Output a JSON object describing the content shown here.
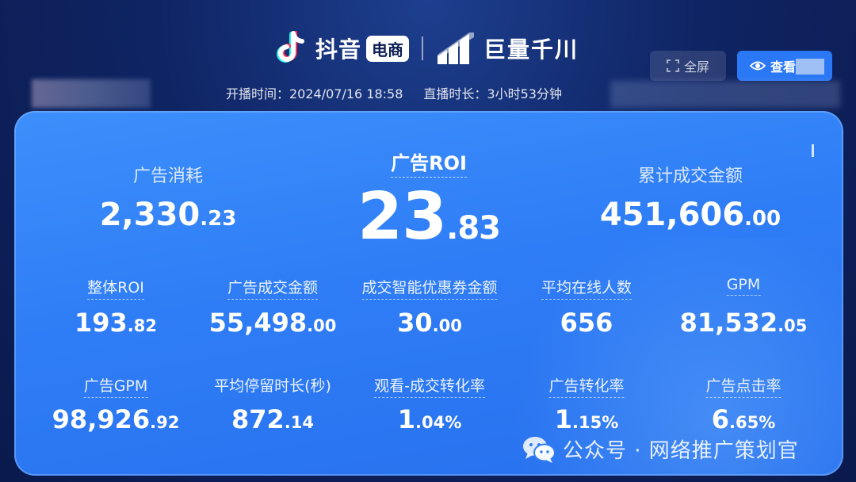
{
  "header": {
    "brand_douyin": "抖音",
    "brand_dianshang": "电商",
    "brand_juliang": "巨量千川",
    "fullscreen_label": "全屏",
    "view_label": "查看"
  },
  "meta": {
    "start_time": "开播时间：2024/07/16 18:58",
    "duration": "直播时长：3小时53分钟"
  },
  "top_metrics": [
    {
      "label": "广告消耗",
      "int": "2,330",
      "dec": ".23"
    },
    {
      "label": "广告ROI",
      "int": "23",
      "dec": ".83"
    },
    {
      "label": "累计成交金额",
      "int": "451,606",
      "dec": ".00"
    }
  ],
  "row1": [
    {
      "label": "整体ROI",
      "int": "193",
      "dec": ".82"
    },
    {
      "label": "广告成交金额",
      "int": "55,498",
      "dec": ".00"
    },
    {
      "label": "成交智能优惠券金额",
      "int": "30",
      "dec": ".00"
    },
    {
      "label": "平均在线人数",
      "int": "656",
      "dec": ""
    },
    {
      "label": "GPM",
      "int": "81,532",
      "dec": ".05"
    }
  ],
  "row2": [
    {
      "label": "广告GPM",
      "int": "98,926",
      "dec": ".92"
    },
    {
      "label": "平均停留时长(秒)",
      "int": "872",
      "dec": ".14"
    },
    {
      "label": "观看-成交转化率",
      "int": "1",
      "dec": ".04%"
    },
    {
      "label": "广告转化率",
      "int": "1",
      "dec": ".15%"
    },
    {
      "label": "广告点击率",
      "int": "6",
      "dec": ".65%"
    }
  ],
  "watermark": {
    "text": "公众号 · 网络推广策划官"
  },
  "colors": {
    "background": "#0f2463",
    "panel": "#2f7df6",
    "button": "#2a78f5"
  }
}
